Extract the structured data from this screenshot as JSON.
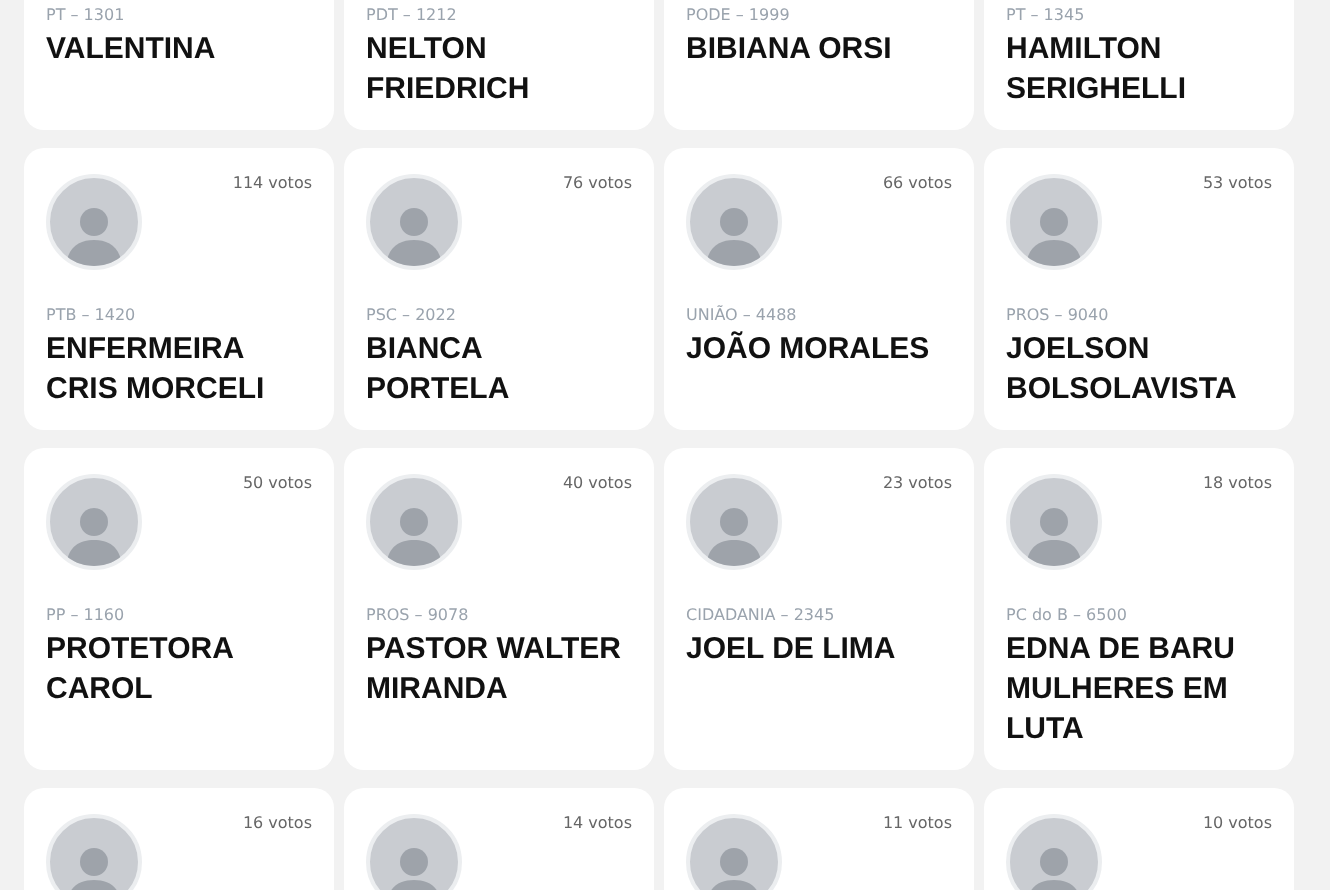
{
  "candidates": [
    {
      "party": "PT – 1301",
      "name": "VALENTINA",
      "photo": false
    },
    {
      "party": "PDT – 1212",
      "name": "NELTON FRIEDRICH",
      "photo": false
    },
    {
      "party": "PODE – 1999",
      "name": "BIBIANA ORSI",
      "photo": false
    },
    {
      "party": "PT – 1345",
      "name": "HAMILTON SERIGHELLI",
      "photo": false
    },
    {
      "votes": "114 votos",
      "photo": true,
      "party": "PTB – 1420",
      "name": "ENFERMEIRA CRIS MORCELI"
    },
    {
      "votes": "76 votos",
      "photo": true,
      "party": "PSC – 2022",
      "name": "BIANCA PORTELA"
    },
    {
      "votes": "66 votos",
      "photo": true,
      "party": "UNIÃO – 4488",
      "name": "JOÃO MORALES"
    },
    {
      "votes": "53 votos",
      "photo": true,
      "party": "PROS – 9040",
      "name": "JOELSON BOLSOLAVISTA"
    },
    {
      "votes": "50 votos",
      "photo": true,
      "party": "PP – 1160",
      "name": "PROTETORA CAROL"
    },
    {
      "votes": "40 votos",
      "photo": true,
      "party": "PROS – 9078",
      "name": "PASTOR WALTER MIRANDA"
    },
    {
      "votes": "23 votos",
      "photo": true,
      "party": "CIDADANIA – 2345",
      "name": "JOEL DE LIMA"
    },
    {
      "votes": "18 votos",
      "photo": true,
      "party": "PC do B – 6500",
      "name": "EDNA DE BARU MULHERES EM LUTA"
    },
    {
      "votes": "16 votos",
      "photo": true
    },
    {
      "votes": "14 votos",
      "photo": true
    },
    {
      "votes": "11 votos",
      "photo": true
    },
    {
      "votes": "10 votos",
      "photo": true
    }
  ]
}
